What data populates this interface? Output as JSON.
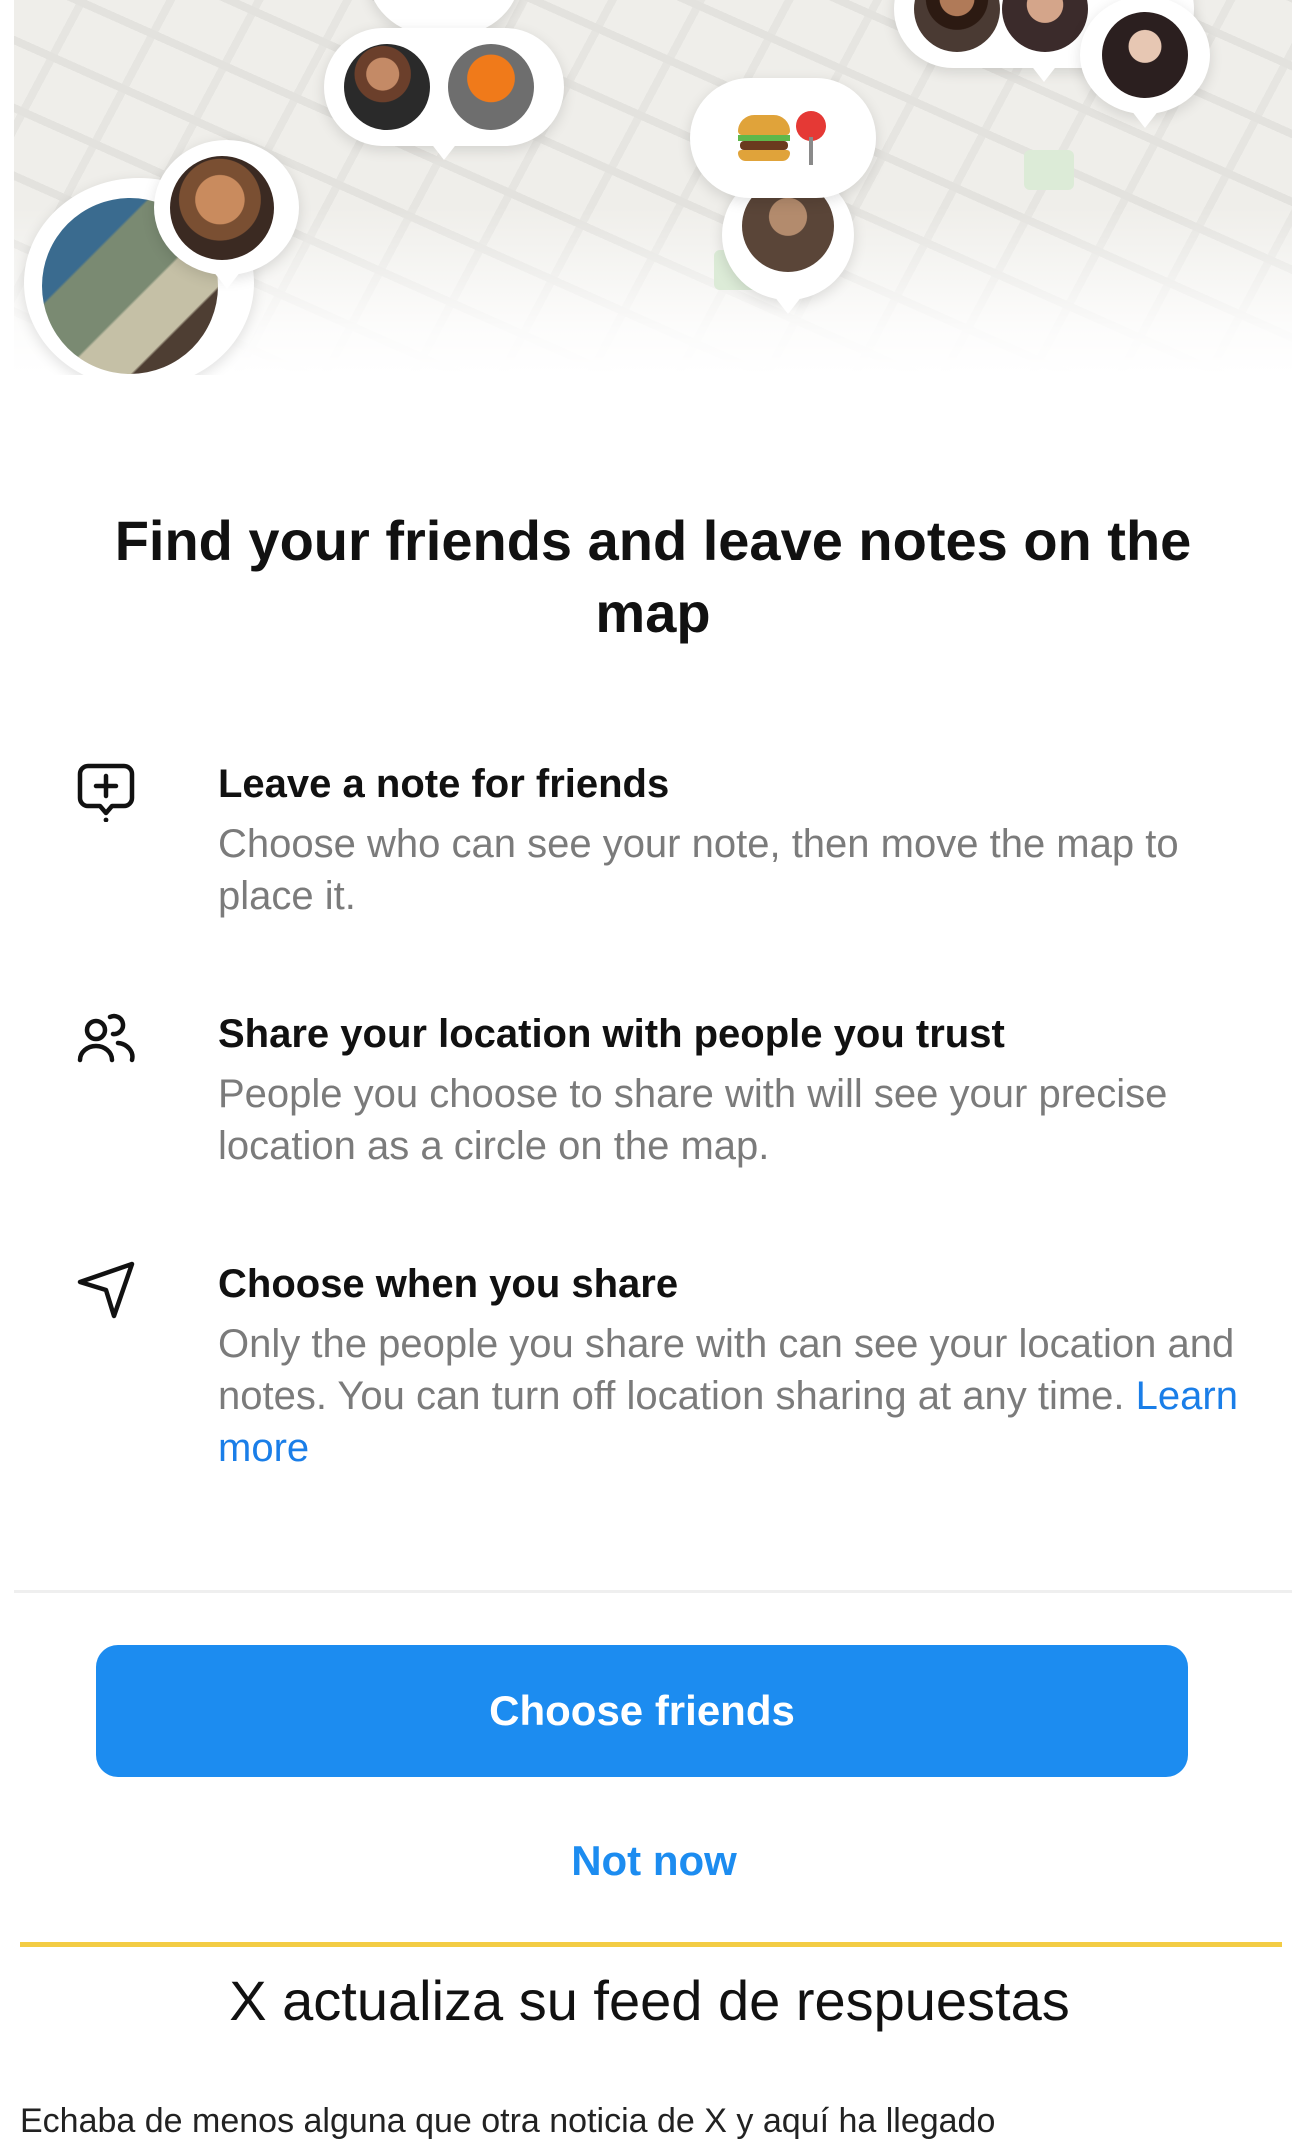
{
  "modal": {
    "title": "Find your friends and leave notes on the map",
    "features": [
      {
        "icon": "note-add-icon",
        "title": "Leave a note for friends",
        "description": "Choose who can see your note, then move the map to place it."
      },
      {
        "icon": "people-icon",
        "title": "Share your location with people you trust",
        "description": "People you choose to share with will see your precise location as a circle on the map."
      },
      {
        "icon": "navigation-arrow-icon",
        "title": "Choose when you share",
        "description": "Only the people you share with can see your location and notes. You can turn off location sharing at any time.",
        "link": "Learn more"
      }
    ],
    "primary_button": "Choose friends",
    "secondary_button": "Not now"
  },
  "article": {
    "heading": "X actualiza su feed de respuestas",
    "body_fragment": "Echaba de menos alguna que otra noticia de X y aquí ha llegado"
  },
  "colors": {
    "accent": "#1c8cf0",
    "link": "#1a7ee8",
    "rule": "#f3cc44"
  }
}
